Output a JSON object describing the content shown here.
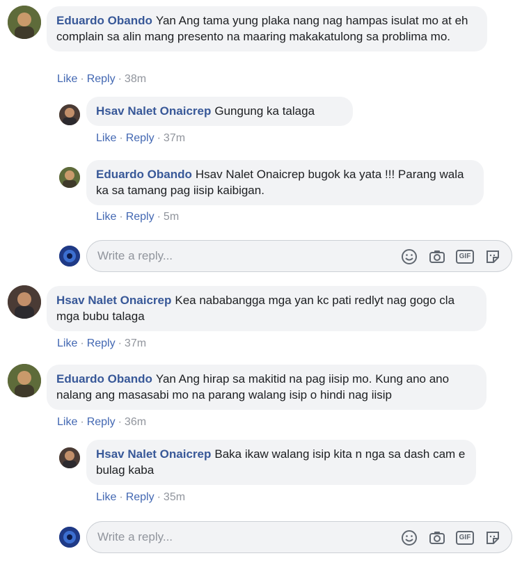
{
  "comments": [
    {
      "author": "Eduardo Obando",
      "text": "Yan Ang tama yung plaka nang nag hampas isulat mo at eh complain sa alin mang presento na maaring makakatulong sa problima mo.",
      "like": "Like",
      "reply": "Reply",
      "time": "38m",
      "replies": [
        {
          "author": "Hsav Nalet Onaicrep",
          "text": "Gungung ka talaga",
          "like": "Like",
          "reply": "Reply",
          "time": "37m"
        },
        {
          "author": "Eduardo Obando",
          "text": "Hsav Nalet Onaicrep bugok ka yata !!! Parang wala ka sa tamang pag iisip kaibigan.",
          "like": "Like",
          "reply": "Reply",
          "time": "5m"
        }
      ]
    },
    {
      "author": "Hsav Nalet Onaicrep",
      "text": "Kea nababangga mga yan kc pati redlyt nag gogo cla mga bubu talaga",
      "like": "Like",
      "reply": "Reply",
      "time": "37m"
    },
    {
      "author": "Eduardo Obando",
      "text": "Yan Ang hirap sa makitid na pag iisip mo. Kung ano ano nalang ang masasabi mo na parang walang isip o hindi nag iisip",
      "like": "Like",
      "reply": "Reply",
      "time": "36m",
      "replies": [
        {
          "author": "Hsav Nalet Onaicrep",
          "text": "Baka ikaw walang isip kita n nga sa dash cam e bulag kaba",
          "like": "Like",
          "reply": "Reply",
          "time": "35m"
        }
      ]
    }
  ],
  "reply_box": {
    "placeholder": "Write a reply...",
    "gif_label": "GIF"
  },
  "colors": {
    "author": "#385898",
    "link": "#4267b2",
    "bubble": "#f2f3f5",
    "meta": "#90949c"
  }
}
